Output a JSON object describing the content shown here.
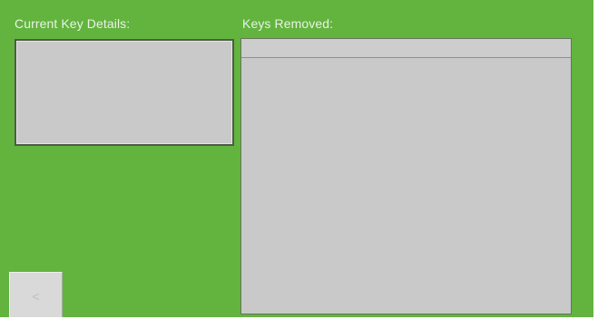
{
  "labels": {
    "current_key_details": "Current Key Details:",
    "keys_removed": "Keys Removed:"
  },
  "back_button": {
    "glyph": "<",
    "icon": "chevron-left-icon"
  },
  "colors": {
    "background": "#62b43e",
    "label_text": "#e9f2e4",
    "panel_fill": "#c9c9c9",
    "panel_border": "#4f5a4b",
    "button_fill": "#d9d9d9"
  }
}
